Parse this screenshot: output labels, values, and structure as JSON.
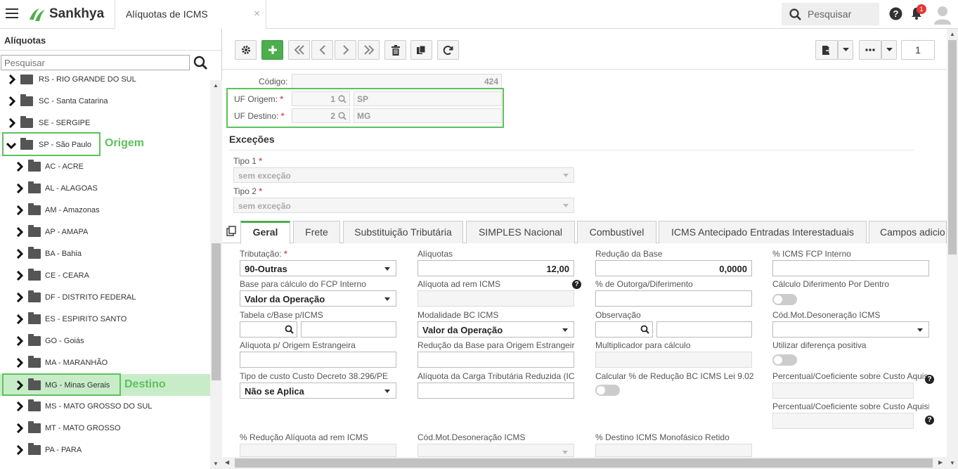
{
  "topbar": {
    "brand": "Sankhya",
    "tab_title": "Alíquotas de ICMS",
    "tab_close": "×",
    "search_placeholder": "Pesquisar",
    "notifications": "1",
    "brand_color": "#4cae4c"
  },
  "sidebar": {
    "title": "Alíquotas",
    "search_placeholder": "Pesquisar",
    "items": [
      {
        "label": "RS - RIO GRANDE DO SUL"
      },
      {
        "label": "SC - Santa Catarina"
      },
      {
        "label": "SE - SERGIPE"
      },
      {
        "label": "SP - São Paulo"
      },
      {
        "label": "AC - ACRE"
      },
      {
        "label": "AL - ALAGOAS"
      },
      {
        "label": "AM - Amazonas"
      },
      {
        "label": "AP - AMAPA"
      },
      {
        "label": "BA - Bahia"
      },
      {
        "label": "CE - CEARA"
      },
      {
        "label": "DF - DISTRITO FEDERAL"
      },
      {
        "label": "ES - ESPIRITO SANTO"
      },
      {
        "label": "GO - Goiás"
      },
      {
        "label": "MA - MARANHÃO"
      },
      {
        "label": "MG - Minas Gerais"
      },
      {
        "label": "MS - MATO GROSSO DO SUL"
      },
      {
        "label": "MT - MATO GROSSO"
      },
      {
        "label": "PA - PARA"
      }
    ],
    "annotation_origem": "Origem",
    "annotation_destino": "Destino",
    "highlight_color": "#5cc25c"
  },
  "toolbar": {
    "page_number": "1"
  },
  "form": {
    "codigo_label": "Código:",
    "codigo_value": "424",
    "uf_origem_label": "UF Origem:",
    "uf_origem_code": "1",
    "uf_origem_name": "SP",
    "uf_destino_label": "UF Destino:",
    "uf_destino_code": "2",
    "uf_destino_name": "MG",
    "required_mark": "*"
  },
  "excecoes": {
    "title": "Exceções",
    "tipo1_label": "Tipo 1",
    "tipo1_value": "sem exceção",
    "tipo2_label": "Tipo 2",
    "tipo2_value": "sem exceção"
  },
  "tabs": [
    {
      "label": "Geral"
    },
    {
      "label": "Frete"
    },
    {
      "label": "Substituição Tributária"
    },
    {
      "label": "SIMPLES Nacional"
    },
    {
      "label": "Combustível"
    },
    {
      "label": "ICMS Antecipado Entradas Interestaduais"
    },
    {
      "label": "Campos adicio"
    }
  ],
  "geral": {
    "tributacao_label": "Tributação:",
    "tributacao_value": "90-Outras",
    "aliquotas_label": "Alíquotas",
    "aliquotas_value": "12,00",
    "reducao_base_label": "Redução da Base",
    "reducao_base_value": "0,0000",
    "icms_fcp_label": "% ICMS FCP Interno",
    "base_fcp_label": "Base para cálculo do FCP Interno",
    "base_fcp_value": "Valor da Operação",
    "aliq_adrem_label": "Alíquota ad rem ICMS",
    "outorga_label": "% de Outorga/Diferimento",
    "calc_dif_label": "Cálculo Diferimento Por Dentro",
    "tabela_label": "Tabela c/Base p/ICMS",
    "modalidade_label": "Modalidade BC ICMS",
    "modalidade_value": "Valor da Operação",
    "observacao_label": "Observação",
    "cod_mot_label": "Cód.Mot.Desoneração ICMS",
    "aliq_estrangeira_label": "Alíquota p/ Origem Estrangeira",
    "reducao_estrangeira_label": "Redução da Base para Origem Estrangeir",
    "multiplicador_label": "Multiplicador para cálculo",
    "dif_positiva_label": "Utilizar diferença positiva",
    "tipo_custo_label": "Tipo de custo Custo Decreto 38.296/PE",
    "tipo_custo_value": "Não se Aplica",
    "carga_reduzida_label": "Alíquota da Carga Tributária Reduzida (IC",
    "calcular_reducao_label": "Calcular % de Redução BC ICMS Lei 9.02",
    "percentual1_label": "Percentual/Coeficiente sobre Custo Aquis",
    "percentual2_label": "Percentual/Coeficiente sobre Custo Aquisi",
    "reducao_adrem_label": "% Redução Alíquota ad rem ICMS",
    "cod_mot2_label": "Cód.Mot.Desoneração ICMS",
    "destino_mono_label": "% Destino ICMS Monofásico Retido",
    "help_glyph": "?"
  }
}
